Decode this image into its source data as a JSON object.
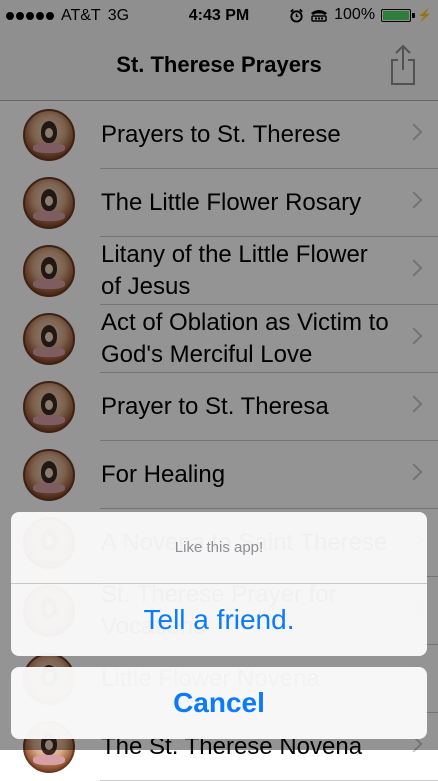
{
  "status_bar": {
    "carrier": "AT&T",
    "network": "3G",
    "time": "4:43 PM",
    "battery": "100%",
    "battery_level": 1.0,
    "icons": [
      "signal-dots-icon",
      "alarm-clock-icon",
      "tty-icon",
      "battery-icon",
      "charging-bolt-icon"
    ]
  },
  "nav": {
    "title": "St. Therese Prayers",
    "share_icon": "share-icon"
  },
  "items": [
    {
      "label": "Prayers to St. Therese"
    },
    {
      "label": "The Little Flower Rosary"
    },
    {
      "label": "Litany of the Little Flower of Jesus"
    },
    {
      "label": "Act of Oblation as Victim to God's Merciful Love"
    },
    {
      "label": "Prayer to St. Theresa"
    },
    {
      "label": "For Healing"
    },
    {
      "label": "A Novena to Saint Therese"
    },
    {
      "label": "St. Therese Prayer for Vocations"
    },
    {
      "label": "Little Flower Novena"
    },
    {
      "label": "The St. Therese Novena"
    }
  ],
  "action_sheet": {
    "message": "Like this app!",
    "action_label": "Tell a friend.",
    "cancel_label": "Cancel"
  },
  "colors": {
    "accent": "#0a7aff",
    "battery_fill": "#4cd964",
    "separator": "#c8c7cc",
    "chevron": "#c7c7cc"
  }
}
